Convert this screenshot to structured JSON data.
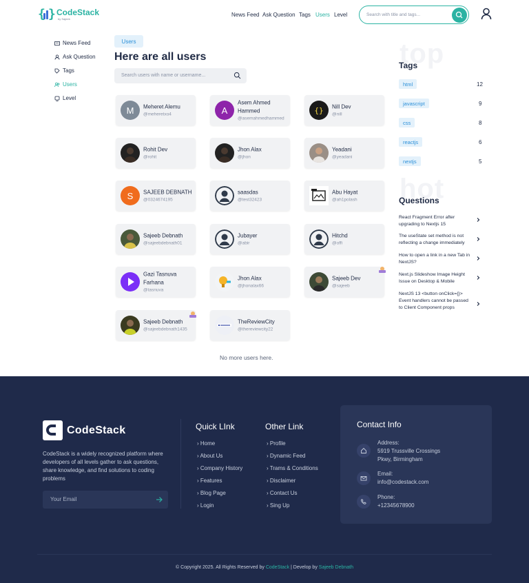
{
  "brand": {
    "name": "CodeStack",
    "byline": "by Sajeeb",
    "accent": "#2bb3a3"
  },
  "nav": [
    "News Feed",
    "Ask Question",
    "Tags",
    "Users",
    "Level"
  ],
  "header_search": {
    "placeholder": "Search with title and tags..."
  },
  "sidebar": [
    "News Feed",
    "Ask Question",
    "Tags",
    "Users",
    "Level"
  ],
  "main": {
    "badge": "Users",
    "title": "Here are all users",
    "search_placeholder": "Search users with name or username...",
    "end_text": "No more users here."
  },
  "users": [
    {
      "name": "Meheret Alemu",
      "username": "@meheretxo4",
      "initial": "M",
      "color": "#7e8a97"
    },
    {
      "name": "Asem Ahmed Hammed",
      "username": "@asemahmedhammed",
      "initial": "A",
      "color": "#8e24aa"
    },
    {
      "name": "Nill Dev",
      "username": "@nill",
      "initial": "",
      "color": "#1a1a1a"
    },
    {
      "name": "Rohit Dev",
      "username": "@rohit",
      "initial": "",
      "color": "#222222"
    },
    {
      "name": "Jhon Alax",
      "username": "@jhon",
      "initial": "",
      "color": "#222222"
    },
    {
      "name": "Yeadani",
      "username": "@yeadani",
      "initial": "",
      "color": "#9a8f86"
    },
    {
      "name": "SAJEEB DEBNATH",
      "username": "@0324674195",
      "initial": "S",
      "color": "#f06c1d"
    },
    {
      "name": "saasdas",
      "username": "@test32423",
      "initial": "",
      "color": "#2f3a4a"
    },
    {
      "name": "Abu Hayat",
      "username": "@ah1polash",
      "initial": "",
      "color": "#ffffff"
    },
    {
      "name": "Sajeeb Debnath",
      "username": "@sajeebdebnath01",
      "initial": "",
      "color": "#4a5a3a"
    },
    {
      "name": "Jubayer",
      "username": "@abir",
      "initial": "",
      "color": "#2f3a4a"
    },
    {
      "name": "Hitchd",
      "username": "@offi",
      "initial": "",
      "color": "#2f3a4a"
    },
    {
      "name": "Gazi Tasnuva Farhana",
      "username": "@tasnuva",
      "initial": "",
      "color": "#7b2ff7"
    },
    {
      "name": "Jhon Alax",
      "username": "@jhonalax66",
      "initial": "",
      "color": "#f2f4f6"
    },
    {
      "name": "Sajeeb Dev",
      "username": "@sajeeb",
      "initial": "",
      "color": "#3d4a36"
    },
    {
      "name": "Sajeeb Debnath",
      "username": "@sajeebdebnath1435",
      "initial": "",
      "color": "#3a3a20"
    },
    {
      "name": "TheReviewCity",
      "username": "@thereviewcity22",
      "initial": "",
      "color": "#eef0f6"
    }
  ],
  "tags_panel": {
    "watermark": "top",
    "title": "Tags",
    "items": [
      {
        "name": "html",
        "count": "12"
      },
      {
        "name": "javascript",
        "count": "9"
      },
      {
        "name": "css",
        "count": "8"
      },
      {
        "name": "reactjs",
        "count": "6"
      },
      {
        "name": "nextjs",
        "count": "5"
      }
    ]
  },
  "questions_panel": {
    "watermark": "hot",
    "title": "Questions",
    "items": [
      "React Fragment Error after upgrading to Nextjs 15",
      "The useState set method is not reflecting a change immediately",
      "How to open a link in a new Tab in NextJS?",
      "Next.js Slideshow Image Height Issue on Desktop & Mobile",
      "NextJS 13 <button onClick={}> Event handlers cannot be passed to Client Component props"
    ]
  },
  "footer": {
    "brand": "CodeStack",
    "description": "CodeStack is a widely recognized platform where developers of all levels gather to ask questions, share knowledge, and find solutions to coding problems",
    "email_placeholder": "Your Email",
    "quick_title": "Quick LInk",
    "quick_links": [
      "Home",
      "About Us",
      "Company History",
      "Features",
      "Blog Page",
      "Login"
    ],
    "other_title": "Other Link",
    "other_links": [
      "Profile",
      "Dynamic Feed",
      "Trams & Conditions",
      "Disclaimer",
      "Contact Us",
      "Sing Up"
    ],
    "contact_title": "Contact Info",
    "address_label": "Address:",
    "address_line1": "5919 Trussville Crossings",
    "address_line2": "Pkwy, Birmingham",
    "email_label": "Email:",
    "email_value": "info@codestack.com",
    "phone_label": "Phone:",
    "phone_value": "+12345678900",
    "copy_prefix": "© Copyright 2025. All Rights Reserved by",
    "copy_brand": "CodeStack",
    "copy_mid": "| Develop by",
    "copy_dev": "Sajeeb Debnath",
    "bg_color": "#1f2a4a"
  }
}
